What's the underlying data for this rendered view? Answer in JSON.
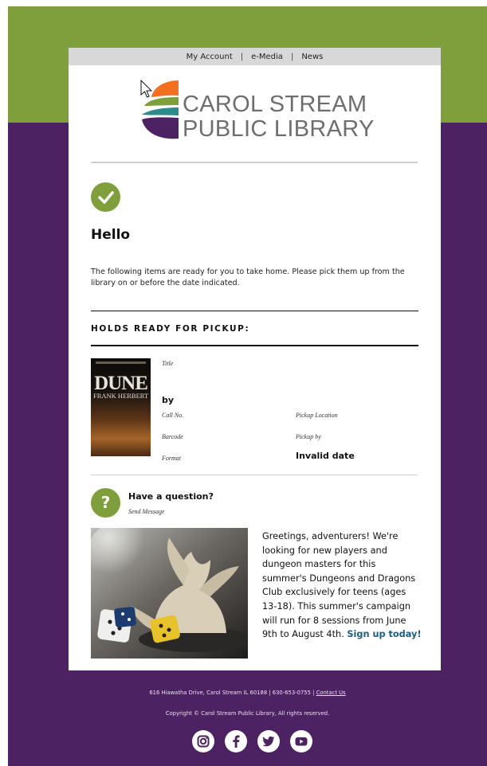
{
  "nav": {
    "items": [
      "My Account",
      "e-Media",
      "News"
    ],
    "separator": "|"
  },
  "logo": {
    "line1": "CAROL STREAM",
    "line2": "PUBLIC LIBRARY",
    "icon": "library-logo-icon"
  },
  "message": {
    "greeting": "Hello",
    "intro": "The following items are ready for you to take home. Please pick them up from the library on or before the date indicated."
  },
  "holds": {
    "heading": "HOLDS READY FOR PICKUP:",
    "item": {
      "cover_title": "DUNE",
      "cover_author": "FRANK HERBERT",
      "title_label": "Title",
      "by_text": "by",
      "call_no_label": "Call No.",
      "barcode_label": "Barcode",
      "format_label": "Format",
      "pickup_location_label": "Pickup Location",
      "pickup_by_label": "Pickup by",
      "pickup_by_value": "Invalid date"
    }
  },
  "question": {
    "title": "Have a question?",
    "link": "Send Message",
    "icon": "question-icon"
  },
  "promo": {
    "text": "Greetings, adventurers! We're looking for new players and dungeon masters for this summer's Dungeons and Dragons Club exclusively for teens (ages 13-18). This summer's campaign will run for 8 sessions from June 9th to August 4th.",
    "cta": "Sign up today!",
    "image": "dragon-figurine-and-dice-photo"
  },
  "footer": {
    "address": "616 Hiawatha Drive, Carol Stream IL 60188 | 630-653-0755 |",
    "contact": "Contact Us",
    "copyright": "Copyright © Carol Stream Public Library, All rights reserved.",
    "social": [
      "instagram-icon",
      "facebook-icon",
      "twitter-icon",
      "youtube-icon"
    ]
  },
  "colors": {
    "green": "#7f9f3d",
    "purple": "#4d2262",
    "orange": "#f37021",
    "teal": "#2e8b8b",
    "link_blue": "#1c5e82"
  }
}
